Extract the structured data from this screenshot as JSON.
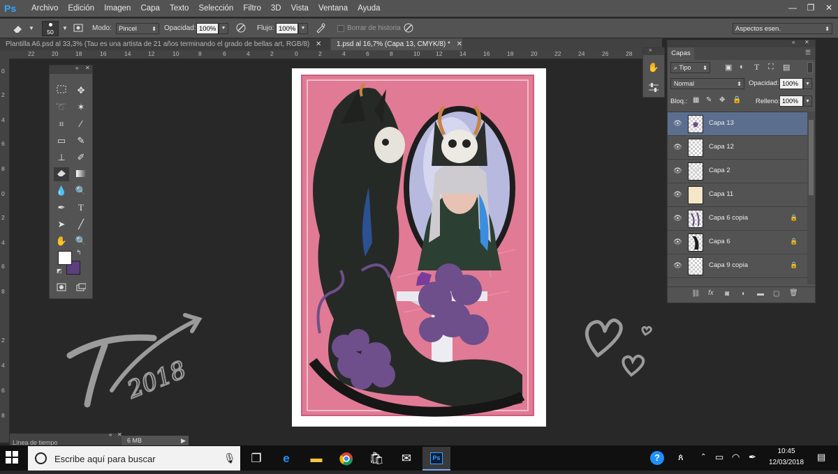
{
  "menu": {
    "logo": "Ps",
    "items": [
      "Archivo",
      "Edición",
      "Imagen",
      "Capa",
      "Texto",
      "Selección",
      "Filtro",
      "3D",
      "Vista",
      "Ventana",
      "Ayuda"
    ]
  },
  "window_controls": {
    "minimize": "—",
    "restore": "❐",
    "close": "✕"
  },
  "options": {
    "brush_size": "50",
    "mode_label": "Modo:",
    "mode_value": "Pincel",
    "opacity_label": "Opacidad:",
    "opacity_value": "100%",
    "flow_label": "Flujo:",
    "flow_value": "100%",
    "history_label": "Borrar de historia",
    "workspace": "Aspectos esen."
  },
  "tabs": [
    {
      "label": "Plantilla A6.psd al 33,3% (Tau es una artista de 21 años terminando el grado de bellas art, RGB/8)",
      "close": "✕"
    },
    {
      "label": "1.psd al 16,7% (Capa 13, CMYK/8) *",
      "close": "✕"
    }
  ],
  "rulers": {
    "top": [
      "22",
      "20",
      "18",
      "16",
      "14",
      "12",
      "10",
      "8",
      "6",
      "4",
      "2",
      "0",
      "2",
      "4",
      "6",
      "8",
      "10",
      "12",
      "14",
      "16",
      "18",
      "20",
      "22",
      "24",
      "26",
      "28"
    ],
    "left": [
      "0",
      "2",
      "4",
      "6",
      "8",
      "0",
      "2",
      "4",
      "6",
      "8",
      "2",
      "4",
      "6",
      "8"
    ]
  },
  "layers_panel": {
    "title": "Capas",
    "filter": "Tipo",
    "blend_mode": "Normal",
    "opacity_label": "Opacidad:",
    "opacity_value": "100%",
    "lock_label": "Bloq.:",
    "fill_label": "Relleno:",
    "fill_value": "100%",
    "layers": [
      {
        "name": "Capa 13",
        "selected": true,
        "locked": false
      },
      {
        "name": "Capa 12",
        "selected": false,
        "locked": false
      },
      {
        "name": "Capa 2",
        "selected": false,
        "locked": false
      },
      {
        "name": "Capa 11",
        "selected": false,
        "locked": false
      },
      {
        "name": "Capa 6 copia",
        "selected": false,
        "locked": true
      },
      {
        "name": "Capa 6",
        "selected": false,
        "locked": true
      },
      {
        "name": "Capa 9 copia",
        "selected": false,
        "locked": true
      }
    ]
  },
  "bottom": {
    "timeline_label": "Línea de tiempo",
    "status": "6 MB"
  },
  "taskbar": {
    "search_placeholder": "Escribe aquí para buscar",
    "time": "10:45",
    "date": "12/03/2018"
  },
  "colors": {
    "foreground": "#ffffff",
    "background": "#5b3f7c",
    "card_pink": "#e17a95",
    "selected_layer": "#5b6e8e"
  },
  "overlay_signature": "T 2018"
}
